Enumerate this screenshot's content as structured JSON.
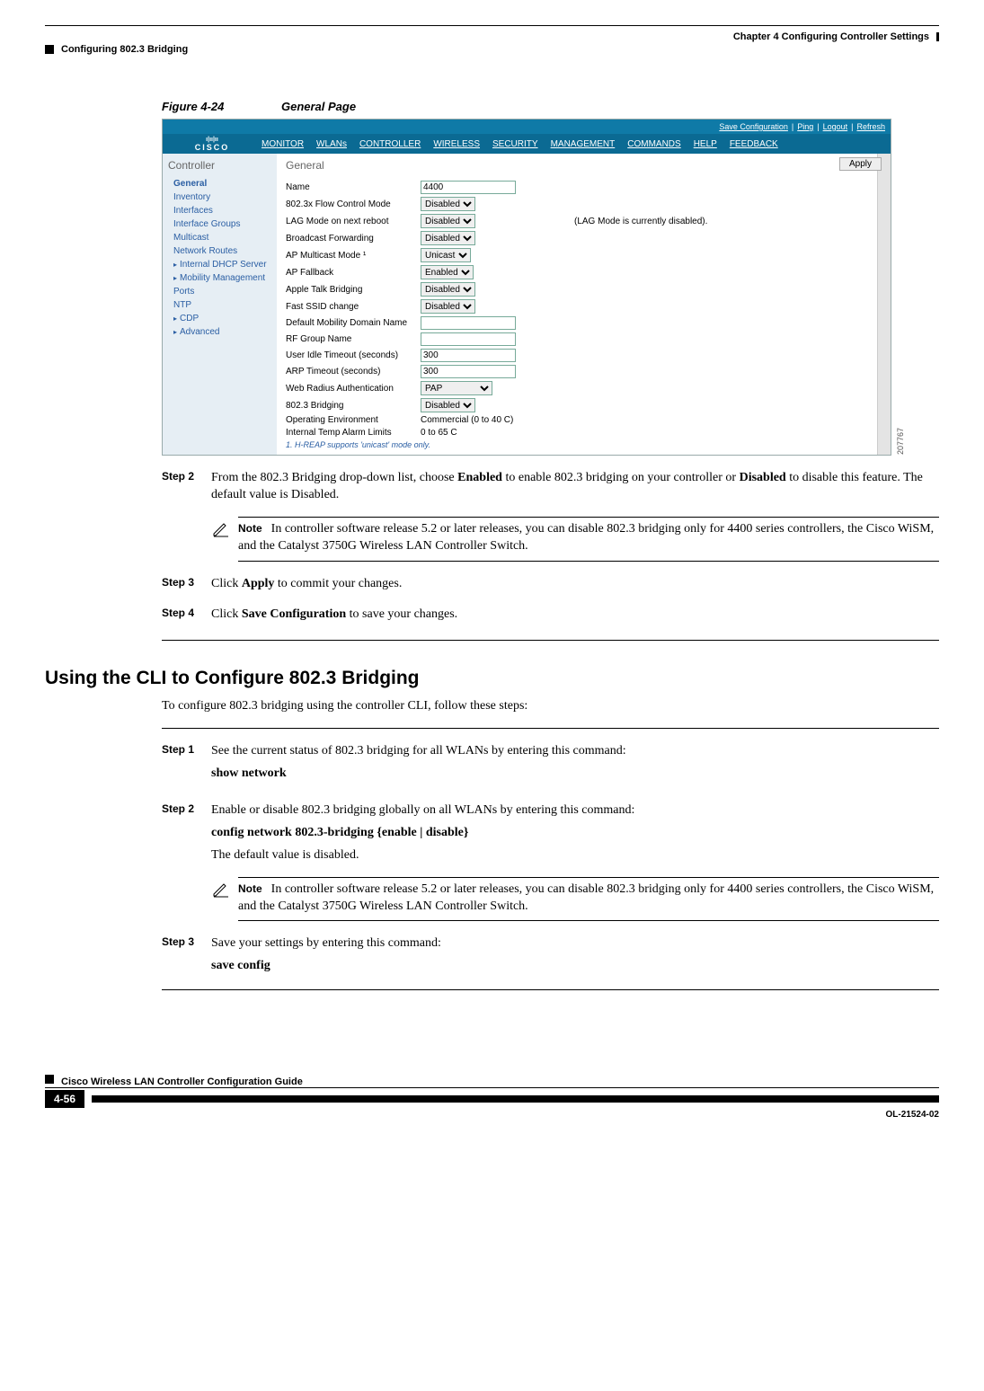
{
  "header": {
    "chapter": "Chapter 4      Configuring Controller Settings",
    "section": "Configuring 802.3 Bridging"
  },
  "figure": {
    "label": "Figure 4-24",
    "title": "General Page",
    "sideId": "207767"
  },
  "shot": {
    "toplinks": {
      "save": "Save Configuration",
      "sep1": "|",
      "ping": "Ping",
      "sep2": "|",
      "logout": "Logout",
      "sep3": "|",
      "refresh": "Refresh"
    },
    "logo": "CISCO",
    "menu": [
      "MONITOR",
      "WLANs",
      "CONTROLLER",
      "WIRELESS",
      "SECURITY",
      "MANAGEMENT",
      "COMMANDS",
      "HELP",
      "FEEDBACK"
    ],
    "sidebar": {
      "title": "Controller",
      "items": [
        {
          "label": "General",
          "caret": false
        },
        {
          "label": "Inventory",
          "caret": false
        },
        {
          "label": "Interfaces",
          "caret": false
        },
        {
          "label": "Interface Groups",
          "caret": false
        },
        {
          "label": "Multicast",
          "caret": false
        },
        {
          "label": "Network Routes",
          "caret": false
        },
        {
          "label": "Internal DHCP Server",
          "caret": true
        },
        {
          "label": "Mobility Management",
          "caret": true
        },
        {
          "label": "Ports",
          "caret": false
        },
        {
          "label": "NTP",
          "caret": false
        },
        {
          "label": "CDP",
          "caret": true
        },
        {
          "label": "Advanced",
          "caret": true
        }
      ]
    },
    "main": {
      "title": "General",
      "apply": "Apply",
      "rows": [
        {
          "label": "Name",
          "type": "text",
          "value": "4400"
        },
        {
          "label": "802.3x Flow Control Mode",
          "type": "select",
          "value": "Disabled"
        },
        {
          "label": "LAG Mode on next reboot",
          "type": "select",
          "value": "Disabled",
          "extra": "(LAG Mode is currently disabled)."
        },
        {
          "label": "Broadcast Forwarding",
          "type": "select",
          "value": "Disabled"
        },
        {
          "label": "AP Multicast Mode ¹",
          "type": "select",
          "value": "Unicast"
        },
        {
          "label": "AP Fallback",
          "type": "select",
          "value": "Enabled"
        },
        {
          "label": "Apple Talk Bridging",
          "type": "select",
          "value": "Disabled"
        },
        {
          "label": "Fast SSID change",
          "type": "select",
          "value": "Disabled"
        },
        {
          "label": "Default Mobility Domain Name",
          "type": "text",
          "value": ""
        },
        {
          "label": "RF Group Name",
          "type": "text",
          "value": ""
        },
        {
          "label": "User Idle Timeout (seconds)",
          "type": "text",
          "value": "300"
        },
        {
          "label": "ARP Timeout (seconds)",
          "type": "text",
          "value": "300"
        },
        {
          "label": "Web Radius Authentication",
          "type": "select",
          "value": "PAP"
        },
        {
          "label": "802.3 Bridging",
          "type": "select",
          "value": "Disabled"
        },
        {
          "label": "Operating Environment",
          "type": "plain",
          "value": "Commercial (0 to 40 C)"
        },
        {
          "label": "Internal Temp Alarm Limits",
          "type": "plain",
          "value": "0 to 65 C"
        }
      ],
      "footnote": "1. H-REAP supports 'unicast' mode only."
    }
  },
  "steps1": {
    "step2": {
      "label": "Step 2",
      "text1": "From the 802.3 Bridging drop-down list, choose ",
      "bold1": "Enabled",
      "text2": " to enable 802.3 bridging on your controller or ",
      "bold2": "Disabled",
      "text3": " to disable this feature. The default value is Disabled."
    },
    "note1": {
      "label": "Note",
      "text": "In controller software release 5.2 or later releases, you can disable 802.3 bridging only for 4400 series controllers, the Cisco WiSM, and the Catalyst 3750G Wireless LAN Controller Switch."
    },
    "step3": {
      "label": "Step 3",
      "text1": "Click ",
      "bold1": "Apply",
      "text2": " to commit your changes."
    },
    "step4": {
      "label": "Step 4",
      "text1": "Click ",
      "bold1": "Save Configuration",
      "text2": " to save your changes."
    }
  },
  "section2": {
    "title": "Using the CLI to Configure 802.3 Bridging",
    "intro": "To configure 802.3 bridging using the controller CLI, follow these steps:",
    "step1": {
      "label": "Step 1",
      "text": "See the current status of 802.3 bridging for all WLANs by entering this command:",
      "cmd": "show network"
    },
    "step2": {
      "label": "Step 2",
      "text": "Enable or disable 802.3 bridging globally on all WLANs by entering this command:",
      "cmd": "config network 802.3-bridging {enable | disable}",
      "after": "The default value is disabled."
    },
    "note2": {
      "label": "Note",
      "text": "In controller software release 5.2 or later releases, you can disable 802.3 bridging only for 4400 series controllers, the Cisco WiSM, and the Catalyst 3750G Wireless LAN Controller Switch."
    },
    "step3": {
      "label": "Step 3",
      "text": "Save your settings by entering this command:",
      "cmd": "save config"
    }
  },
  "footer": {
    "book": "Cisco Wireless LAN Controller Configuration Guide",
    "page": "4-56",
    "docid": "OL-21524-02"
  }
}
